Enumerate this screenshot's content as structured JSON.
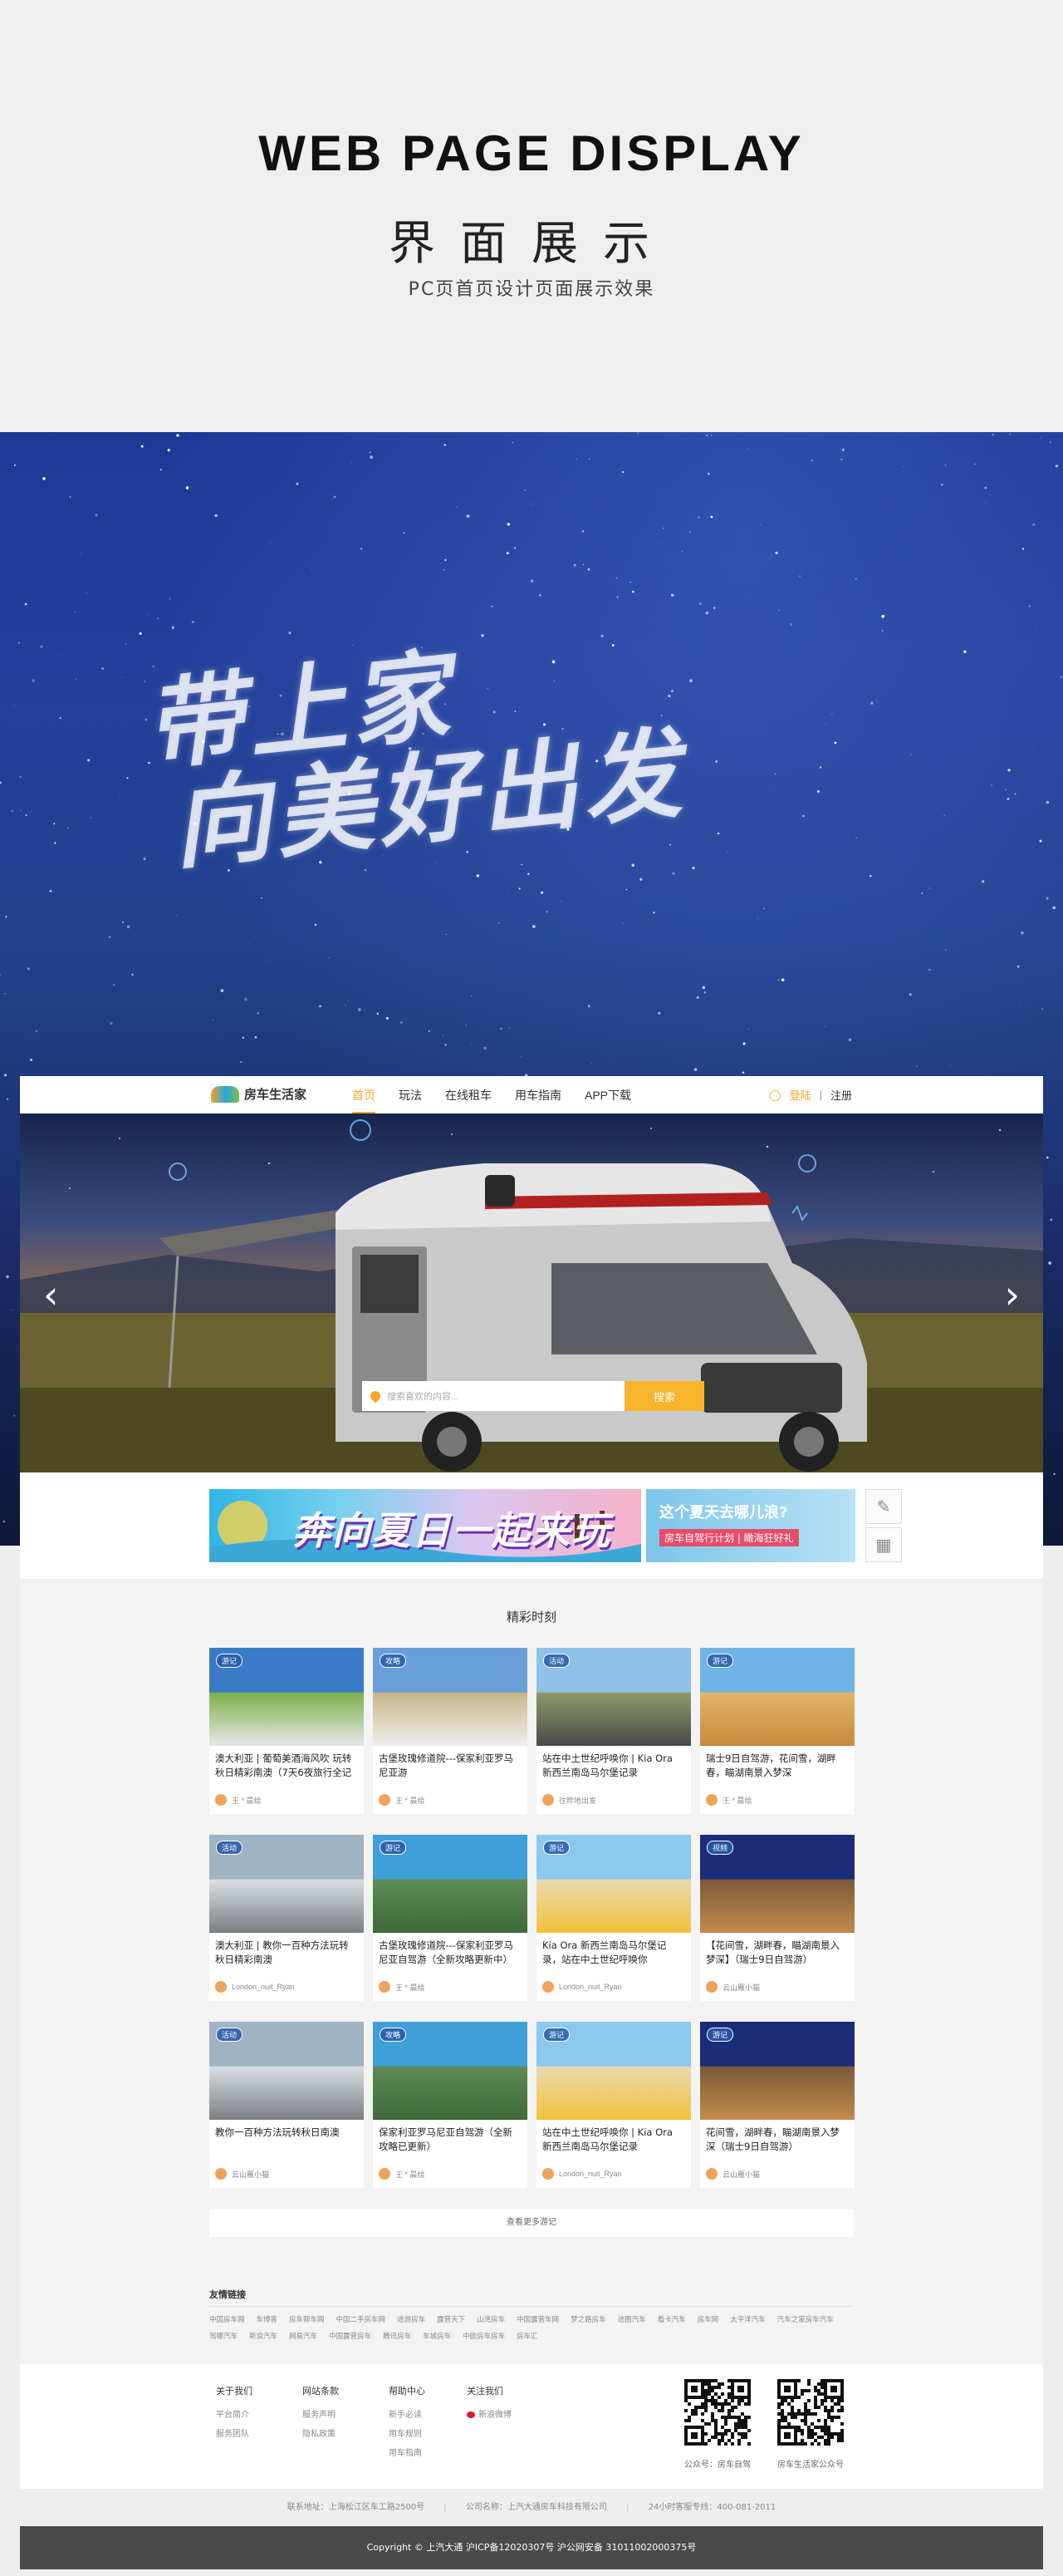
{
  "intro": {
    "en_title": "WEB PAGE DISPLAY",
    "cn_title": "界面展示",
    "subtitle": "PC页首页设计页面展示效果"
  },
  "hero": {
    "calligraphy_line1": "带上家",
    "calligraphy_line2": "向美好出发"
  },
  "nav": {
    "logo_text": "房车生活家",
    "items": [
      "首页",
      "玩法",
      "在线租车",
      "用车指南",
      "APP下载"
    ],
    "active_index": 0,
    "login": "登陆",
    "separator": "|",
    "register": "注册"
  },
  "banner": {
    "prev_icon": "chevron-left-icon",
    "next_icon": "chevron-right-icon",
    "search_placeholder": "搜索喜欢的内容...",
    "search_button": "搜索"
  },
  "promo": {
    "ad1_text": "奔向夏日一起来玩",
    "ad2_line1": "这个夏天去哪儿浪?",
    "ad2_line2": "房车自驾行计划 | 瞰海狂好礼"
  },
  "moments": {
    "title": "精彩时刻",
    "cards": [
      {
        "tag": "游记",
        "title": "澳大利亚 | 葡萄美酒海风吹 玩转秋日精彩南澳（7天6夜旅行全记",
        "author": "王 * 晨绘"
      },
      {
        "tag": "攻略",
        "title": "古堡玫瑰修道院---保家利亚罗马尼亚游",
        "author": "王 * 晨绘"
      },
      {
        "tag": "活动",
        "title": "站在中土世纪呼唤你 | Kia Ora 新西兰南岛马尔堡记录",
        "author": "往昨地出发"
      },
      {
        "tag": "游记",
        "title": "瑞士9日自驾游，花间雪，湖畔春，瞄湖南景入梦深",
        "author": "王 * 晨绘"
      },
      {
        "tag": "活动",
        "title": "澳大利亚 | 教你一百种方法玩转秋日精彩南澳",
        "author": "London_nuit_Ryan"
      },
      {
        "tag": "游记",
        "title": "古堡玫瑰修道院---保家利亚罗马尼亚自驾游（全新攻略更新中）",
        "author": "王 * 晨绘"
      },
      {
        "tag": "游记",
        "title": "Kia Ora 新西兰南岛马尔堡记录，站在中土世纪呼唤你",
        "author": "London_nuit_Ryan"
      },
      {
        "tag": "视频",
        "title": "【花间雪，湖畔春，瞄湖南景入梦深】（瑞士9日自驾游）",
        "author": "云山雁小猫"
      },
      {
        "tag": "活动",
        "title": "教你一百种方法玩转秋日南澳",
        "author": "云山雁小猫"
      },
      {
        "tag": "攻略",
        "title": "保家利亚罗马尼亚自驾游（全新攻略已更新）",
        "author": "王 * 晨绘"
      },
      {
        "tag": "游记",
        "title": "站在中土世纪呼唤你 | Kia Ora 新西兰南岛马尔堡记录",
        "author": "London_nuit_Ryan"
      },
      {
        "tag": "游记",
        "title": "花间雪，湖畔春，瞄湖南景入梦深（瑞士9日自驾游）",
        "author": "云山雁小猫"
      }
    ],
    "more": "查看更多游记"
  },
  "friend_links": {
    "title": "友情链接",
    "items": [
      "中国房车网",
      "车博客",
      "房车帮车网",
      "中国二手房车网",
      "途游房车",
      "露营天下",
      "山湾房车",
      "中国露营车网",
      "梦之路房车",
      "途图汽车",
      "看卡汽车",
      "房车网",
      "太平洋汽车",
      "汽车之家房车汽车",
      "驾哪汽车",
      "新浪汽车",
      "网易汽车",
      "中国露营房车",
      "腾讯房车",
      "车城房车",
      "中欧房车房车",
      "房车汇"
    ]
  },
  "footer": {
    "columns": [
      {
        "heading": "关于我们",
        "items": [
          "平台简介",
          "服务团队"
        ]
      },
      {
        "heading": "网站条款",
        "items": [
          "服务声明",
          "隐私政策"
        ]
      },
      {
        "heading": "帮助中心",
        "items": [
          "新手必读",
          "用车规则",
          "用车指南"
        ]
      },
      {
        "heading": "关注我们",
        "items": [
          "新浪微博"
        ]
      }
    ],
    "qr1_label": "公众号：房车自驾",
    "qr2_label": "房车生活家公众号",
    "contact_address": "联系地址：上海松江区车工路2500号",
    "company": "公司名称：上汽大通房车科技有限公司",
    "hotline": "24小时客服专线：400-081-2011",
    "copyright": "Copyright © 上汽大通 沪ICP备12020307号 沪公网安备 31011002000375号"
  },
  "colors": {
    "accent": "#f5a623",
    "search_button": "#f7b52b",
    "copyright_bg": "#4a4a4a"
  }
}
